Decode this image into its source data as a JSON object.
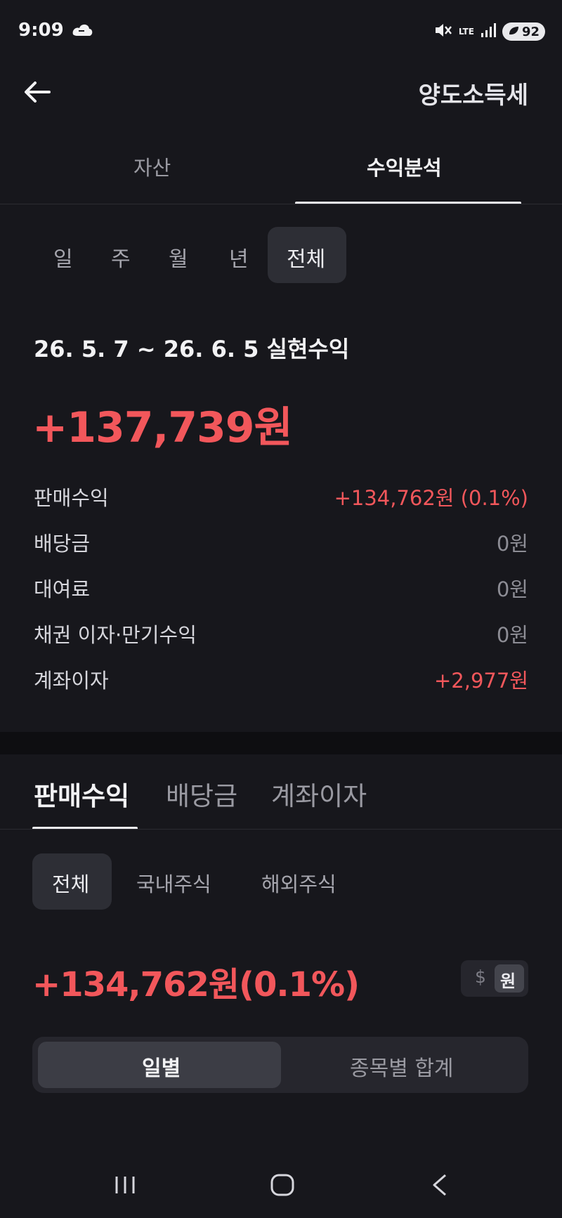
{
  "status_bar": {
    "time": "9:09",
    "network": "LTE",
    "battery": "92"
  },
  "header": {
    "title": "양도소득세"
  },
  "top_tabs": {
    "asset": "자산",
    "profit": "수익분석"
  },
  "period_filters": {
    "day": "일",
    "week": "주",
    "month": "월",
    "year": "년",
    "all": "전체"
  },
  "summary": {
    "range_label": "26. 5. 7 ~ 26. 6. 5 실현수익",
    "total": "+137,739원",
    "rows": [
      {
        "label": "판매수익",
        "value": "+134,762원 (0.1%)"
      },
      {
        "label": "배당금",
        "value": "0원"
      },
      {
        "label": "대여료",
        "value": "0원"
      },
      {
        "label": "채권 이자·만기수익",
        "value": "0원"
      },
      {
        "label": "계좌이자",
        "value": "+2,977원"
      }
    ]
  },
  "detail_tabs": {
    "sales": "판매수익",
    "dividend": "배당금",
    "interest": "계좌이자"
  },
  "market_filters": {
    "all": "전체",
    "domestic": "국내주식",
    "overseas": "해외주식"
  },
  "sales_amount": "+134,762원(0.1%)",
  "currency_toggle": {
    "usd": "$",
    "krw": "원"
  },
  "view_toggle": {
    "daily": "일별",
    "by_stock": "종목별 합계"
  },
  "colors": {
    "positive": "#f2575b",
    "background": "#17171c"
  }
}
